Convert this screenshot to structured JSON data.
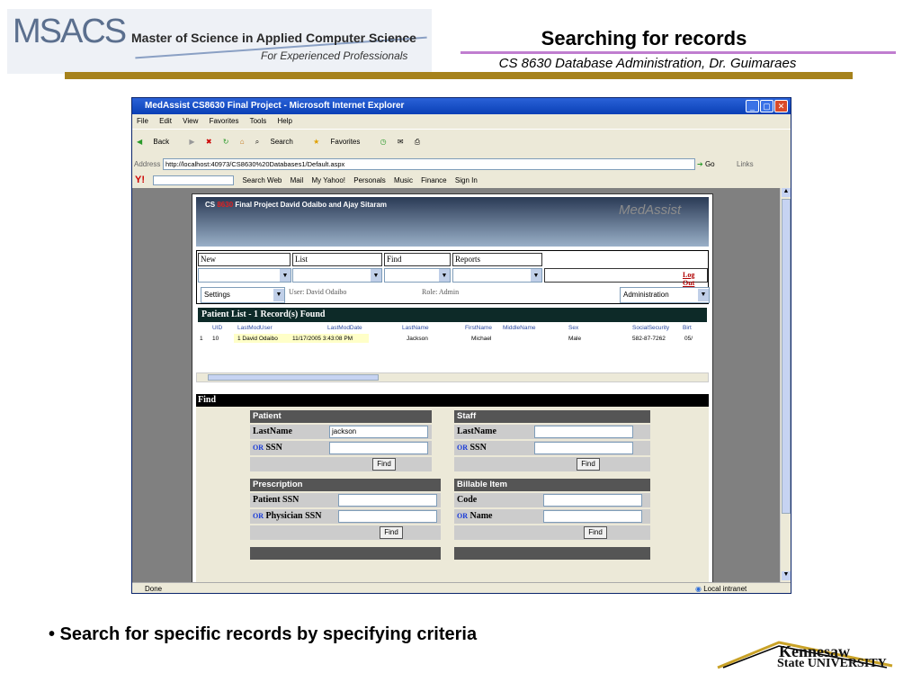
{
  "slide": {
    "logo_abbrev": "MSACS",
    "logo_title": "Master of Science in Applied Computer Science",
    "logo_subtitle": "For Experienced Professionals",
    "title": "Searching for records",
    "subtitle": "CS 8630 Database Administration, Dr. Guimaraes",
    "bullet": "• Search for specific records by specifying criteria",
    "footer_logo_top": "Kennesaw",
    "footer_logo_bottom": "State UNIVERSITY"
  },
  "browser": {
    "title": "MedAssist CS8630 Final Project - Microsoft Internet Explorer",
    "menu": [
      "File",
      "Edit",
      "View",
      "Favorites",
      "Tools",
      "Help"
    ],
    "toolbar": [
      "Back",
      "Search",
      "Favorites"
    ],
    "address_label": "Address",
    "address": "http://localhost:40973/CS8630%20Databases1/Default.aspx",
    "go_label": "Go",
    "links_label": "Links",
    "yahoo": [
      "Search Web",
      "Mail",
      "My Yahoo!",
      "Personals",
      "Music",
      "Finance",
      "Sign In"
    ],
    "status": "Done",
    "zone": "Local intranet"
  },
  "app": {
    "banner_prefix": "CS",
    "banner_num": "8630",
    "banner_title": "Final Project  David Odaibo and Ajay Sitaram",
    "banner_logo": "MedAssist",
    "nav": {
      "new": "New",
      "list": "List",
      "find": "Find",
      "reports": "Reports",
      "logout": "Log Out"
    },
    "settings": "Settings",
    "user": "User: David Odaibo",
    "role": "Role: Admin",
    "admin": "Administration",
    "patient_list_title": "Patient List - 1 Record(s) Found",
    "columns": [
      "UID",
      "LastModUser",
      "LastModDate",
      "LastName",
      "FirstName",
      "MiddleName",
      "Sex",
      "SocialSecurity",
      "Birt"
    ],
    "row": {
      "num": "1",
      "uid": "10",
      "user": "1 David Odaibo",
      "date": "11/17/2005 3:43:08 PM",
      "last": "Jackson",
      "first": "Michael",
      "middle": "",
      "sex": "Male",
      "ssn": "582-87-7262",
      "birth": "05/"
    },
    "find_title": "Find",
    "patient": {
      "head": "Patient",
      "lastname": "LastName",
      "lastname_value": "jackson",
      "or": "OR",
      "ssn": "SSN",
      "find": "Find"
    },
    "staff": {
      "head": "Staff",
      "lastname": "LastName",
      "or": "OR",
      "ssn": "SSN",
      "find": "Find"
    },
    "prescription": {
      "head": "Prescription",
      "patient_ssn": "Patient SSN",
      "or": "OR",
      "physician_ssn": "Physician SSN",
      "find": "Find"
    },
    "billable": {
      "head": "Billable Item",
      "code": "Code",
      "or": "OR",
      "name": "Name",
      "find": "Find"
    }
  }
}
